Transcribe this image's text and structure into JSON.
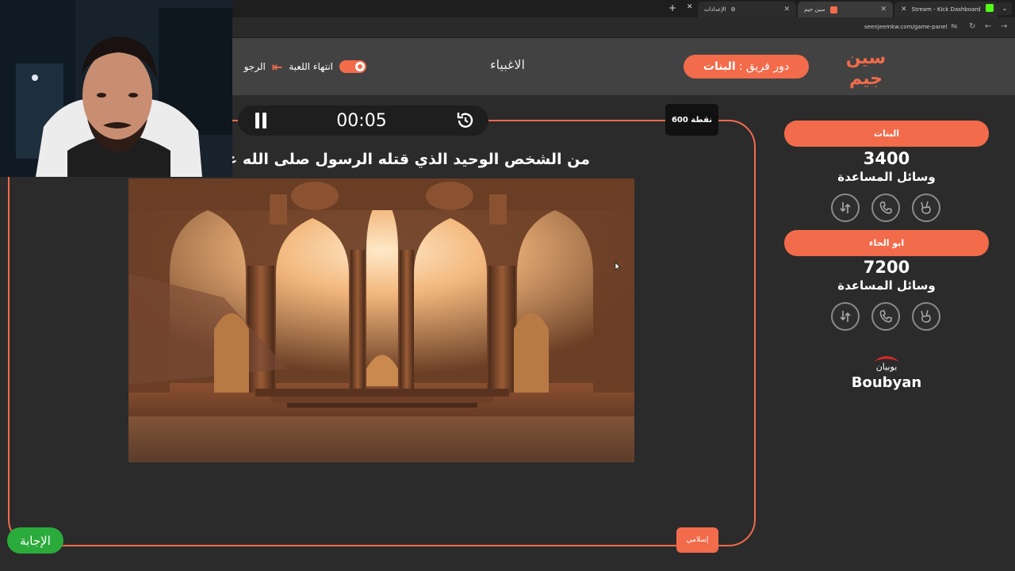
{
  "browser": {
    "tabs": [
      {
        "title": "الإعدادات"
      },
      {
        "title": "سين جيم"
      },
      {
        "title": "Stream - Kick Dashboard"
      }
    ],
    "url": "seenjeemkw.com/game-panel"
  },
  "header": {
    "logo_text": "سين جيم",
    "turn_label": "دور فريق :",
    "turn_team": "البنات",
    "center_title": "الاغبياء",
    "end_game_label": "انتهاء اللعبة",
    "back_label": "الرجو"
  },
  "question": {
    "timer": "00:05",
    "points": "600 نقطة",
    "text": "من الشخص الوحيد الذي قتله الرسول صلى الله عليه وسلم",
    "category": "إسلامي",
    "answer_button": "الإجابة"
  },
  "teams": [
    {
      "name": "البنات",
      "score": "3400",
      "aids_label": "وسائل المساعدة",
      "aids": [
        "swap-icon",
        "phone-icon",
        "victory-hand-icon"
      ]
    },
    {
      "name": "ابو الحاء",
      "score": "7200",
      "aids_label": "وسائل المساعدة",
      "aids": [
        "swap-icon",
        "phone-icon",
        "victory-hand-icon"
      ]
    }
  ],
  "sponsor": {
    "arabic": "بوبيان",
    "english": "Boubyan"
  },
  "colors": {
    "accent": "#f26b4b",
    "answer": "#2bab3c",
    "header": "#424242",
    "background": "#2b2b2b"
  }
}
